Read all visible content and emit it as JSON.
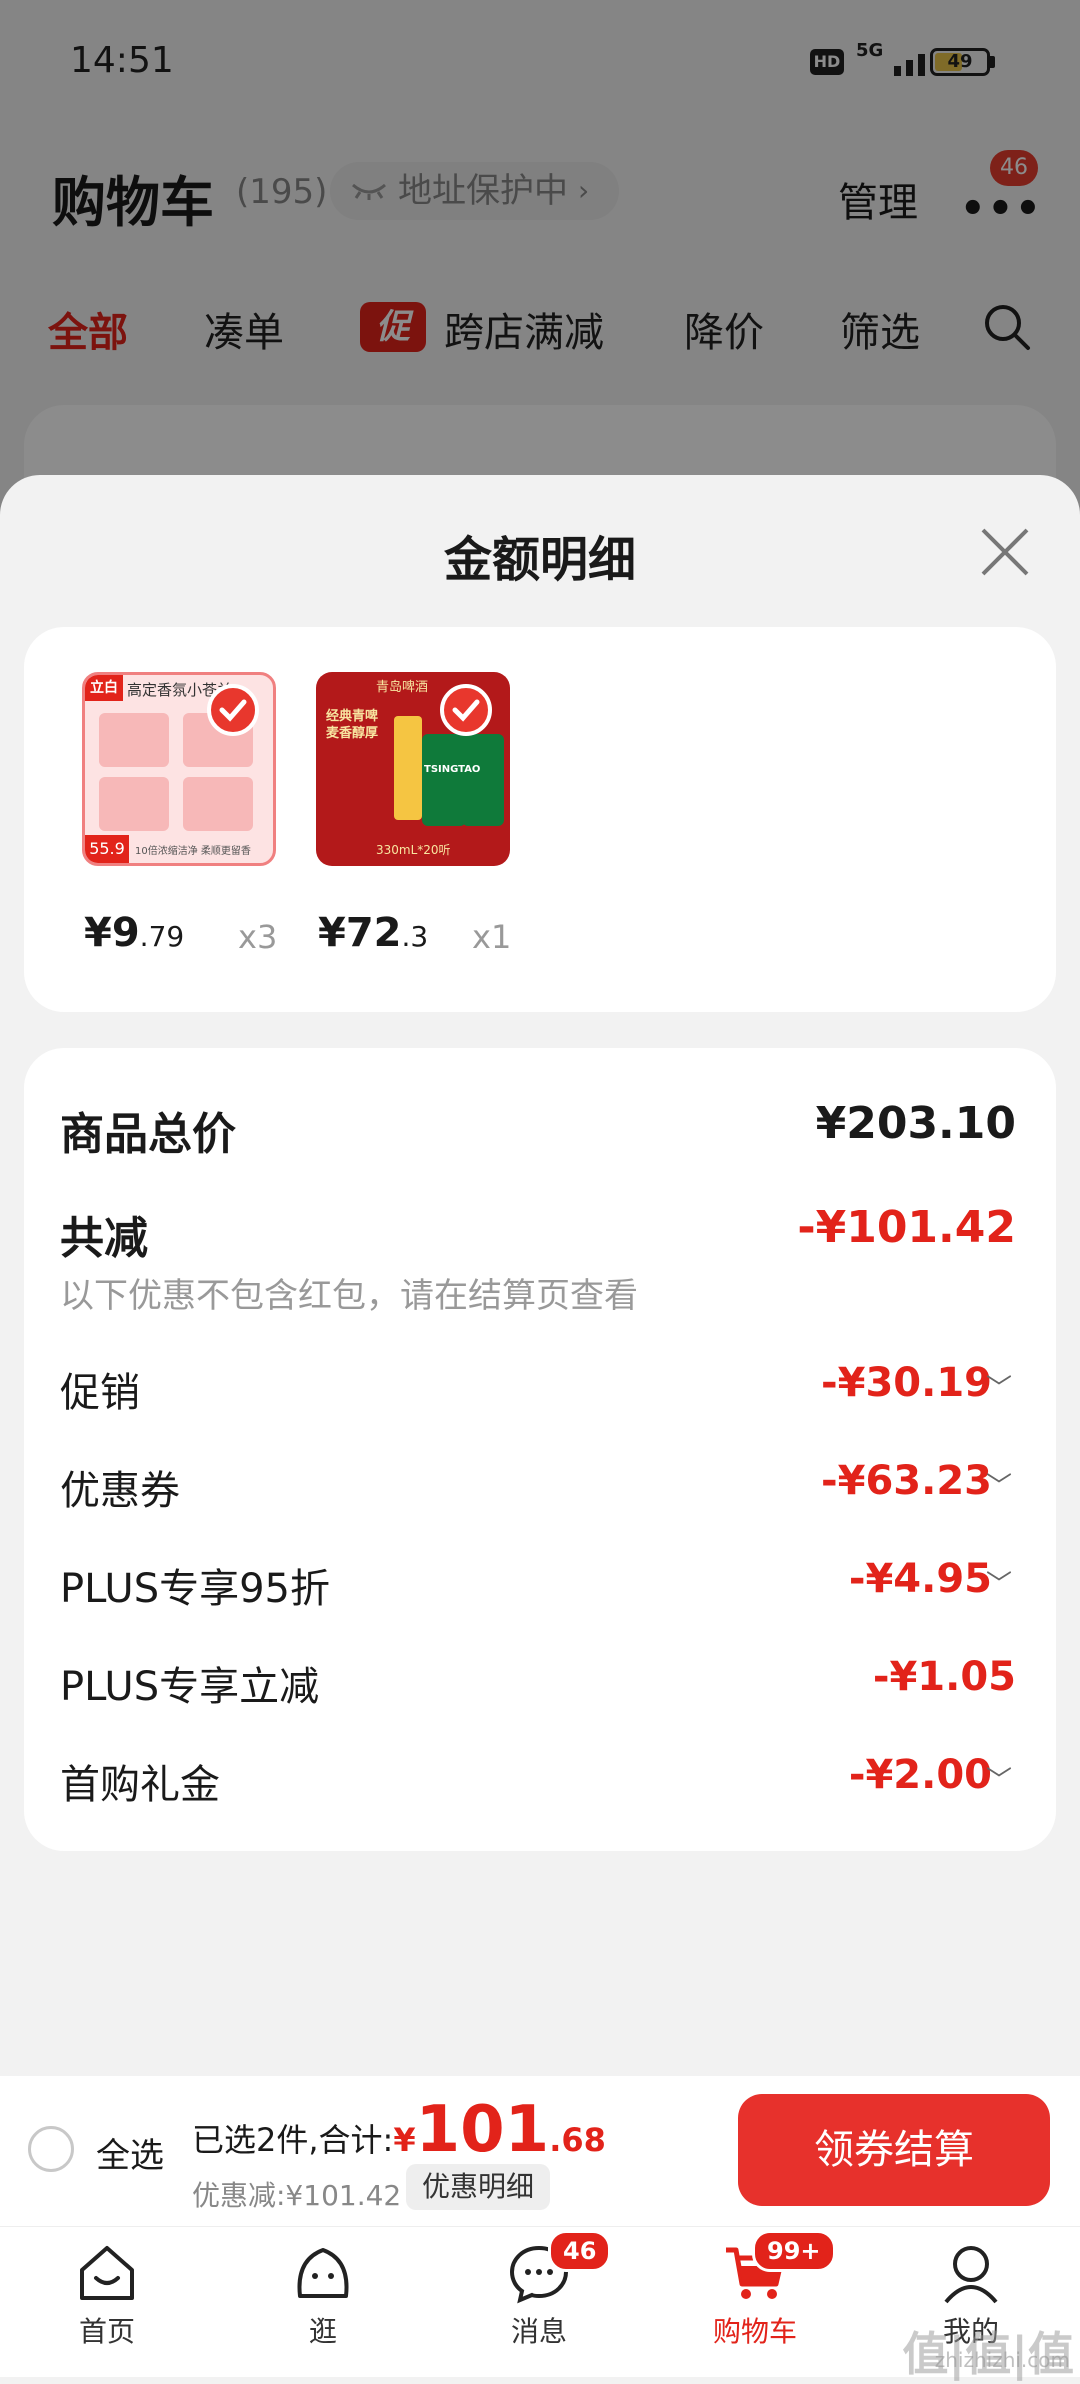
{
  "status": {
    "time": "14:51",
    "hd": "HD",
    "network": "5G",
    "battery": "49"
  },
  "header": {
    "title": "购物车",
    "count": "(195)",
    "address_protect": "地址保护中",
    "manage": "管理",
    "more_badge": "46"
  },
  "tabs": [
    {
      "label": "全部"
    },
    {
      "label": "凑单"
    },
    {
      "label": "促",
      "icon": "promo-badge"
    },
    {
      "label": "跨店满减"
    },
    {
      "label": "降价"
    },
    {
      "label": "筛选"
    }
  ],
  "sheet": {
    "title": "金额明细",
    "items": [
      {
        "price_int": "¥9",
        "price_dec": ".79",
        "qty": "x3",
        "thumb": {
          "brand": "立白",
          "headline": "高定香氛小苍兰",
          "caption": "10倍浓缩洁净 柔顺更留香",
          "tag": "55.9"
        }
      },
      {
        "price_int": "¥72",
        "price_dec": ".3",
        "qty": "x1",
        "thumb": {
          "brand": "青岛啤酒",
          "headline": "经典青啤 麦香醇厚",
          "can": "TSINGTAO",
          "caption": "330mL*20听"
        }
      }
    ],
    "summary": {
      "total_label": "商品总价",
      "total_value": "¥203.10",
      "reduce_label": "共减",
      "reduce_value": "-¥101.42",
      "reduce_note": "以下优惠不包含红包，请在结算页查看",
      "rows": [
        {
          "label": "促销",
          "value": "-¥30.19",
          "expandable": true
        },
        {
          "label": "优惠券",
          "value": "-¥63.23",
          "expandable": true
        },
        {
          "label": "PLUS专享95折",
          "value": "-¥4.95",
          "expandable": true
        },
        {
          "label": "PLUS专享立减",
          "value": "-¥1.05",
          "expandable": false
        },
        {
          "label": "首购礼金",
          "value": "-¥2.00",
          "expandable": true
        }
      ]
    }
  },
  "checkout": {
    "select_all": "全选",
    "selected_text": "已选2件,合计:",
    "yen": "¥",
    "total_int": "101",
    "total_dec": ".68",
    "discount_text": "优惠减:¥101.42",
    "detail_button": "优惠明细",
    "button": "领券结算"
  },
  "nav": [
    {
      "label": "首页",
      "icon": "home-icon"
    },
    {
      "label": "逛",
      "icon": "explore-icon"
    },
    {
      "label": "消息",
      "icon": "message-icon",
      "badge": "46"
    },
    {
      "label": "购物车",
      "icon": "cart-icon",
      "badge": "99+",
      "active": true
    },
    {
      "label": "我的",
      "icon": "profile-icon"
    }
  ],
  "watermark": {
    "main": "值|值|值",
    "sub": "zhizhizhi.com"
  },
  "colors": {
    "accent": "#e2231a",
    "checkout_button": "#e7312c",
    "background": "#f2f2f2"
  }
}
